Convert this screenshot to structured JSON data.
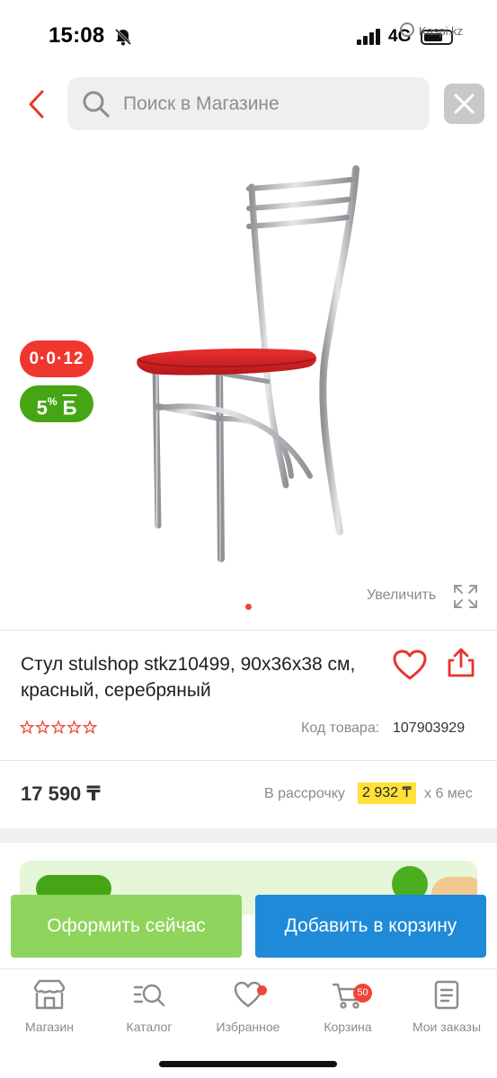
{
  "status_bar": {
    "time": "15:08",
    "network": "4G",
    "watermark": "Kaspi.kz"
  },
  "search": {
    "placeholder": "Поиск в Магазине"
  },
  "badges": {
    "installment": "0·0·12",
    "bonus_value": "5",
    "bonus_suffix": "%",
    "bonus_currency": "Б"
  },
  "gallery": {
    "zoom_label": "Увеличить",
    "current_page": 1,
    "total_pages": 1
  },
  "product": {
    "title": "Стул stulshop stkz10499, 90x36x38 см, красный, серебряный",
    "rating_stars": 0,
    "rating_max": 5,
    "sku_label": "Код товара:",
    "sku_value": "107903929",
    "price": "17 590 ₸",
    "installment_prefix": "В рассрочку",
    "installment_amount": "2 932 ₸",
    "installment_term": "x 6 мес",
    "seat_color": "#e3262a",
    "frame_color": "#b7b9bc"
  },
  "actions": {
    "buy_now": "Оформить сейчас",
    "add_to_cart": "Добавить в корзину"
  },
  "nav": {
    "items": [
      {
        "label": "Магазин",
        "icon": "store-icon"
      },
      {
        "label": "Каталог",
        "icon": "catalog-search-icon"
      },
      {
        "label": "Избранное",
        "icon": "heart-icon"
      },
      {
        "label": "Корзина",
        "icon": "cart-icon",
        "badge": "50"
      },
      {
        "label": "Мои заказы",
        "icon": "orders-icon"
      }
    ]
  },
  "colors": {
    "accent_red": "#f14635",
    "green": "#46a514",
    "blue": "#1e8ad8",
    "light_green": "#8fd45c",
    "yellow": "#ffe13a"
  }
}
